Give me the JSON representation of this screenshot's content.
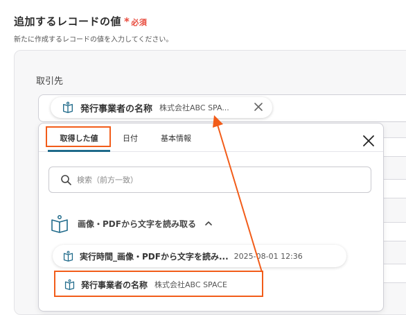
{
  "section": {
    "title": "追加するレコードの値",
    "required_star": "*",
    "required_label": "必須",
    "description": "新たに作成するレコードの値を入力してください。"
  },
  "field": {
    "label": "取引先",
    "chip": {
      "name": "発行事業者の名称",
      "value": "株式会社ABC SPA..."
    }
  },
  "dropdown": {
    "tabs": [
      {
        "label": "取得した値",
        "active": true
      },
      {
        "label": "日付",
        "active": false
      },
      {
        "label": "基本情報",
        "active": false
      }
    ],
    "search_placeholder": "検索（前方一致）",
    "group": {
      "label": "画像・PDFから文字を読み取る",
      "items": [
        {
          "name": "実行時間_画像・PDFから文字を読み...",
          "value": "2025-08-01 12:36"
        },
        {
          "name": "発行事業者の名称",
          "value": "株式会社ABC SPACE"
        }
      ]
    }
  },
  "colors": {
    "accent_highlight": "#f25c19",
    "required": "#e84a3c",
    "active_tab_bar": "#1f6a8a"
  },
  "icons": [
    "book-icon",
    "close-icon",
    "search-icon",
    "chevron-up-icon",
    "book-reader-icon"
  ]
}
